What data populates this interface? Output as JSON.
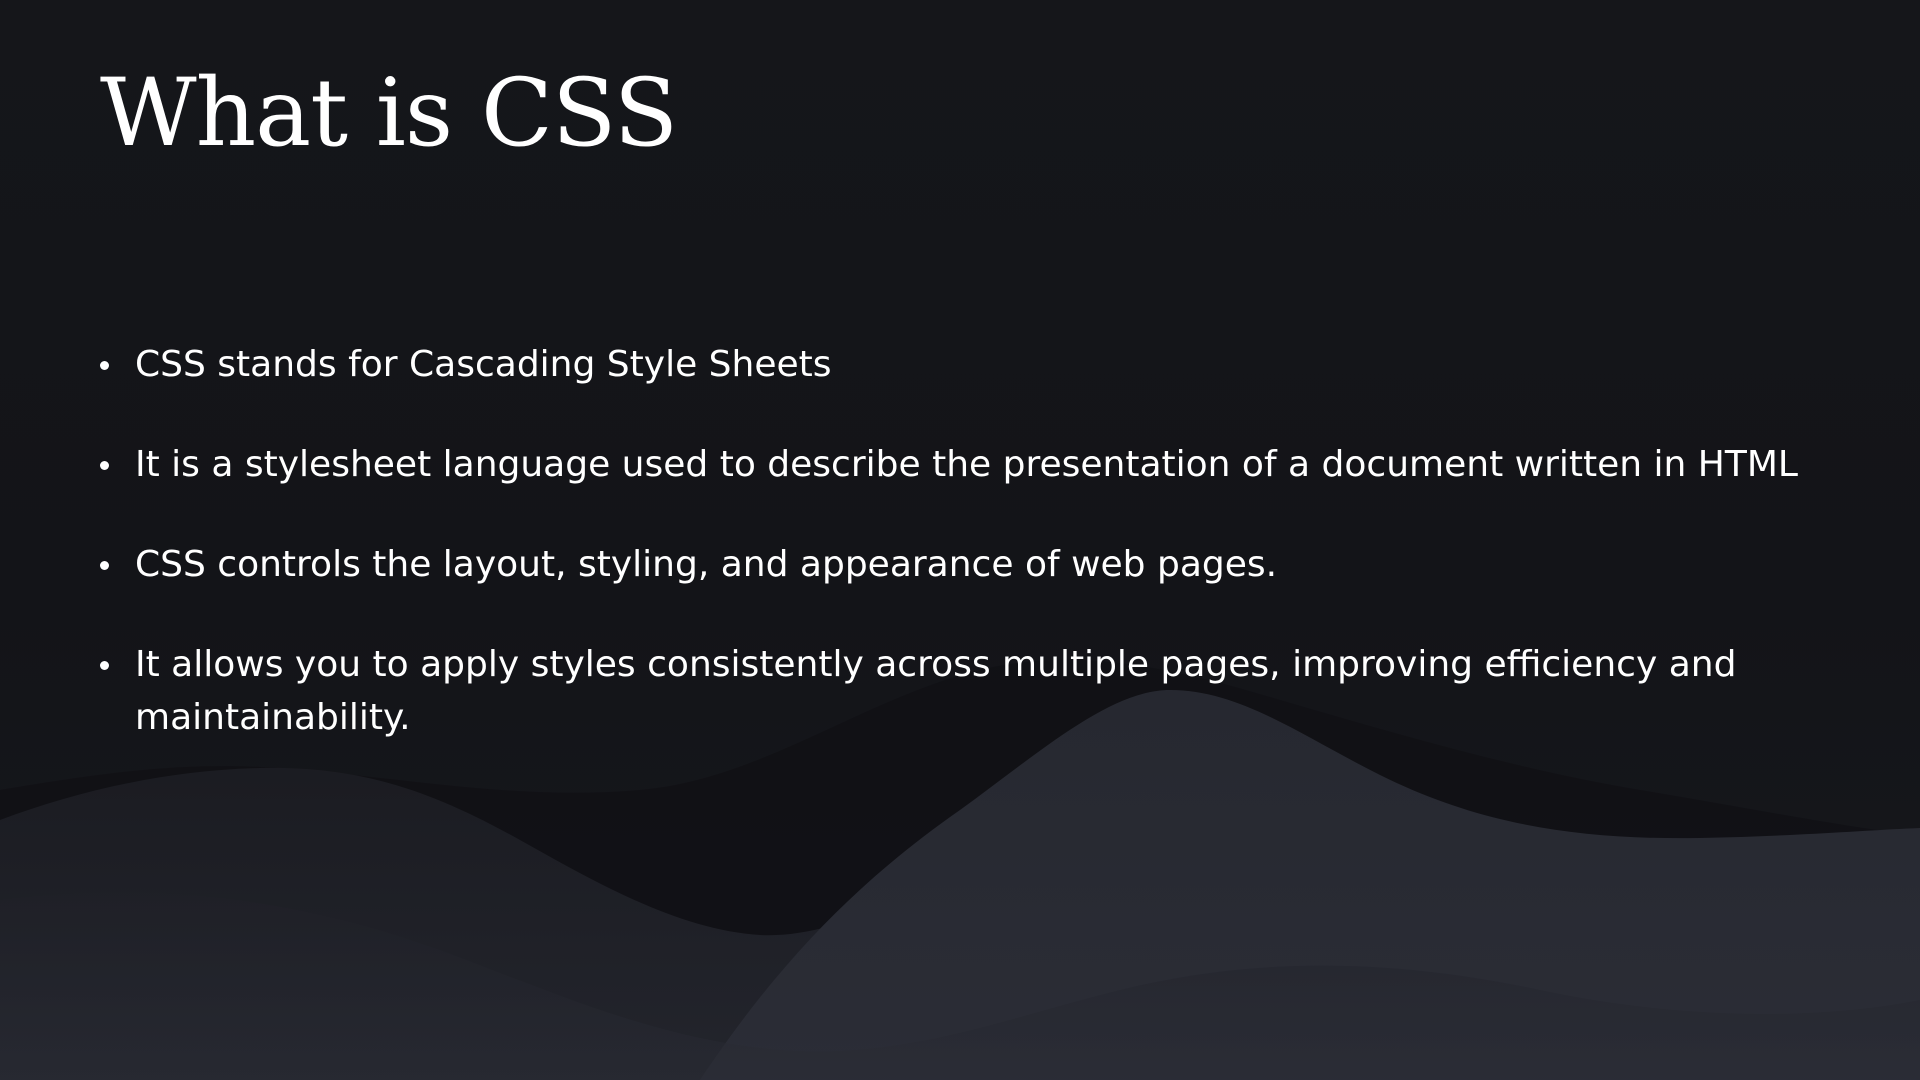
{
  "slide": {
    "title": "What is CSS",
    "bullets": [
      "CSS stands for Cascading Style Sheets",
      "It is a stylesheet language used to describe the presentation of a document written in HTML",
      "CSS controls the layout, styling, and appearance of web pages.",
      "It allows you to apply styles consistently across multiple pages, improving efficiency and maintainability."
    ]
  },
  "colors": {
    "background": "#141519",
    "text": "#ffffff",
    "wave_dark": "#101114",
    "wave_light": "#262830"
  }
}
